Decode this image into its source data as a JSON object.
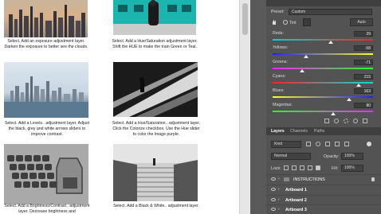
{
  "captions": {
    "c1": "Select. Add an exposure adjustment layer. Darken the exposure to better see the clouds.",
    "c2": "Select. Add a Hue/Saturation adjustment layer. Shift the HUE to make the train Green or Teal.",
    "c3": "Select. Add a Levels.. adjustment layer. Adjust the black, grey and white arrows sliders to improve contrast.",
    "c4": "Select. Add a Hue/Saturation.. adjustment layer. Click the Colorize checkbox. Use the Hue slider to color the image purple.",
    "c5": "Select. Add a Brightness/Contrast.. adjustment layer. Decrease brightness and",
    "c6": "Select. Add a Black & White.. adjustment layer."
  },
  "properties": {
    "preset_label": "Preset:",
    "preset_value": "Custom",
    "tint_label": "Tint",
    "auto_label": "Auto",
    "sliders": [
      {
        "label": "Reds:",
        "value": "29",
        "pct": 0.58
      },
      {
        "label": "Yellows:",
        "value": "-58",
        "pct": 0.33
      },
      {
        "label": "Greens:",
        "value": "-71",
        "pct": 0.29
      },
      {
        "label": "Cyans:",
        "value": "215",
        "pct": 0.86
      },
      {
        "label": "Blues:",
        "value": "163",
        "pct": 0.76
      },
      {
        "label": "Magentas:",
        "value": "80",
        "pct": 0.6
      }
    ]
  },
  "layers_panel": {
    "tabs": [
      "Layers",
      "Channels",
      "Paths"
    ],
    "kind_label": "Kind",
    "blend_mode": "Normal",
    "opacity_label": "Opacity:",
    "opacity_value": "100%",
    "lock_label": "Lock:",
    "fill_label": "Fill:",
    "fill_value": "100%",
    "layers": [
      {
        "name": "INSTRUCTIONS"
      },
      {
        "name": "Artboard 1"
      },
      {
        "name": "Artboard 2"
      },
      {
        "name": "Artboard 3"
      }
    ]
  }
}
